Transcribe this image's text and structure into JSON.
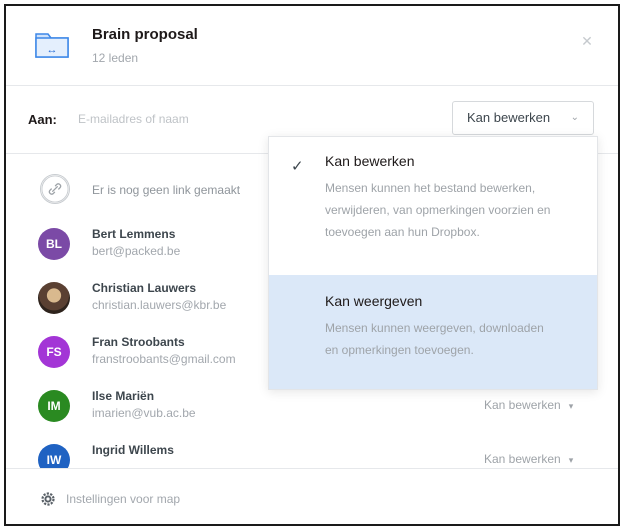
{
  "folder": {
    "title": "Brain proposal",
    "members_count": "12 leden"
  },
  "share": {
    "to_label": "Aan:",
    "to_placeholder": "E-mailadres of naam",
    "permission_button": "Kan bewerken"
  },
  "link_text": "Er is nog geen link gemaakt",
  "members": [
    {
      "initials": "BL",
      "name": "Bert Lemmens",
      "email": "bert@packed.be",
      "color": "#7b4aa6",
      "permission": ""
    },
    {
      "initials": "",
      "name": "Christian Lauwers",
      "email": "christian.lauwers@kbr.be",
      "color": "",
      "permission": ""
    },
    {
      "initials": "FS",
      "name": "Fran Stroobants",
      "email": "franstroobants@gmail.com",
      "color": "#a335d6",
      "permission": ""
    },
    {
      "initials": "IM",
      "name": "Ilse Mariën",
      "email": "imarien@vub.ac.be",
      "color": "#2a8a21",
      "permission": "Kan bewerken"
    },
    {
      "initials": "IW",
      "name": "Ingrid Willems",
      "email": "",
      "color": "#1f62c2",
      "permission": "Kan bewerken"
    }
  ],
  "dropdown": {
    "options": [
      {
        "title": "Kan bewerken",
        "description": "Mensen kunnen het bestand bewerken, verwijderen, van opmerkingen voorzien en toevoegen aan hun Dropbox.",
        "checked": true
      },
      {
        "title": "Kan weergeven",
        "description": "Mensen kunnen weergeven, downloaden en opmerkingen toevoegen.",
        "checked": false,
        "highlighted": true
      }
    ]
  },
  "footer": {
    "settings_label": "Instellingen voor map"
  },
  "icons": {
    "folder": "shared-folder-icon",
    "close": "close-icon",
    "link": "link-icon",
    "gear": "gear-icon",
    "check": "checkmark-icon",
    "chevron": "chevron-down-icon"
  },
  "colors": {
    "accent_blue": "#0061fe",
    "highlight": "#dbe8f8"
  }
}
